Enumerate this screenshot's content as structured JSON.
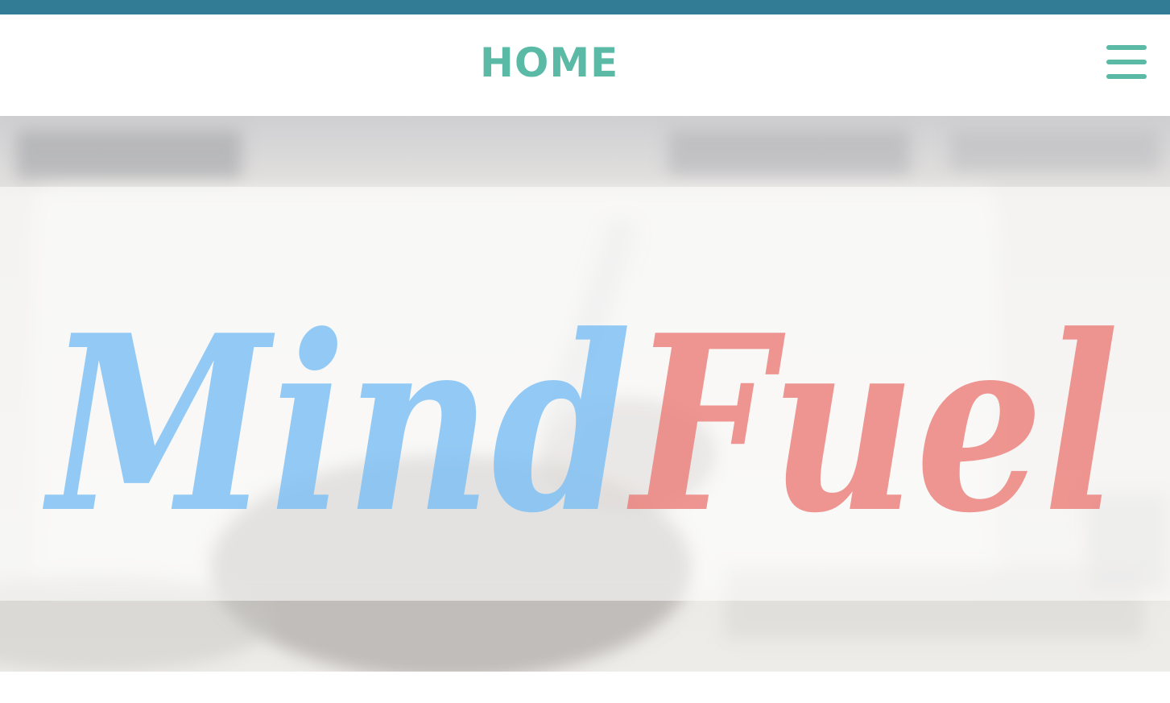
{
  "header": {
    "title": "HOME",
    "menu_icon": "hamburger-menu-icon"
  },
  "hero": {
    "logo_part_1": "Mind",
    "logo_part_2": "Fuel",
    "logo_color_1": "#7cc0f4",
    "logo_color_2": "#ec7f7a"
  },
  "colors": {
    "top_strip": "#327c96",
    "accent": "#5bbaa6"
  }
}
